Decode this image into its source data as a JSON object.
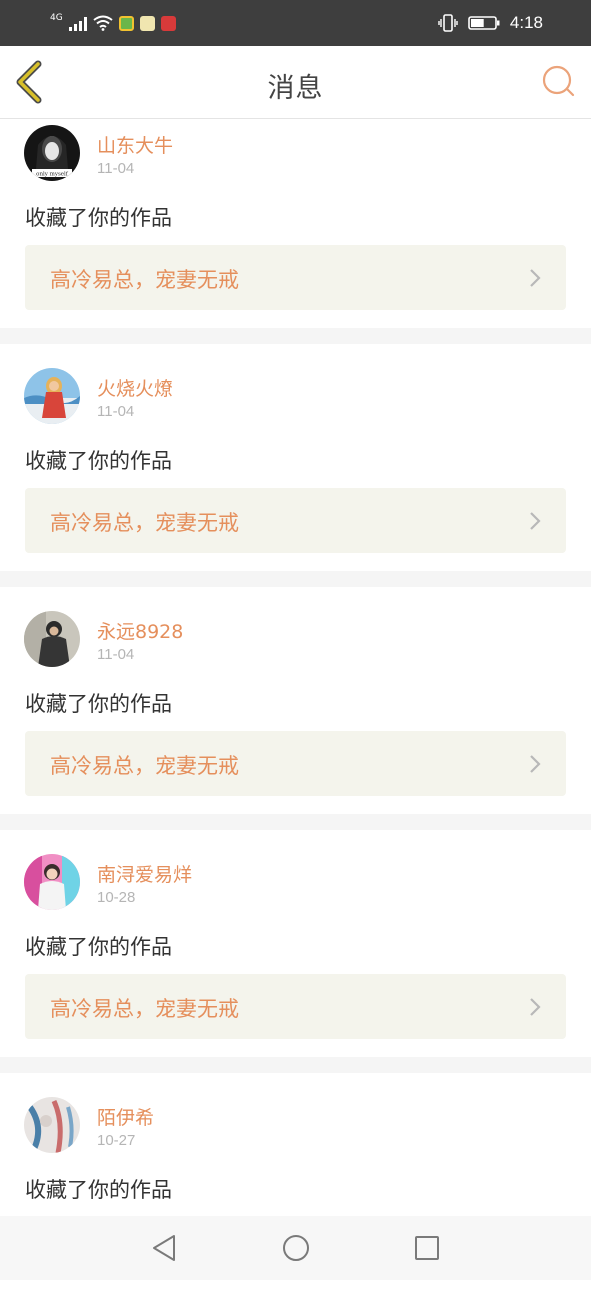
{
  "status_bar": {
    "signal_label": "4G",
    "time": "4:18",
    "battery_level": 0.55
  },
  "header": {
    "title": "消息",
    "back_icon": "chevron-left-icon",
    "search_icon": "search-icon"
  },
  "colors": {
    "accent": "#e58f5c",
    "back_icon": "#d8c02a",
    "status_bar_bg": "#3e3e3e"
  },
  "messages": [
    {
      "username": "山东大牛",
      "date": "11-04",
      "action": "收藏了你的作品",
      "work_title": "高冷易总，宠妻无戒",
      "avatar_watermark": "only myself"
    },
    {
      "username": "火烧火燎",
      "date": "11-04",
      "action": "收藏了你的作品",
      "work_title": "高冷易总，宠妻无戒"
    },
    {
      "username": "永远8928",
      "date": "11-04",
      "action": "收藏了你的作品",
      "work_title": "高冷易总，宠妻无戒"
    },
    {
      "username": "南浔爱易烊",
      "date": "10-28",
      "action": "收藏了你的作品",
      "work_title": "高冷易总，宠妻无戒"
    },
    {
      "username": "陌伊希",
      "date": "10-27",
      "action": "收藏了你的作品",
      "work_title": ""
    }
  ],
  "nav": {
    "back_icon": "triangle-back-icon",
    "home_icon": "circle-home-icon",
    "recents_icon": "square-recents-icon"
  }
}
